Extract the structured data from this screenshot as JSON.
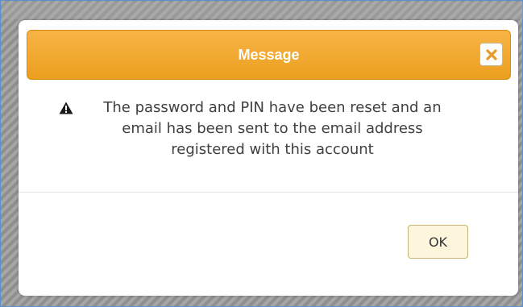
{
  "dialog": {
    "title": "Message",
    "close_icon": "close-icon",
    "warning_icon": "warning-icon",
    "message": "The password and PIN have been reset and an email has been sent to the email address registered with this account",
    "ok_label": "OK"
  },
  "colors": {
    "title_bar": "#eb9f1f",
    "title_text": "#ffffff",
    "close_icon": "#e79a2a",
    "ok_button_bg": "#fdf6dc",
    "frame_border": "#5a8fd0"
  }
}
